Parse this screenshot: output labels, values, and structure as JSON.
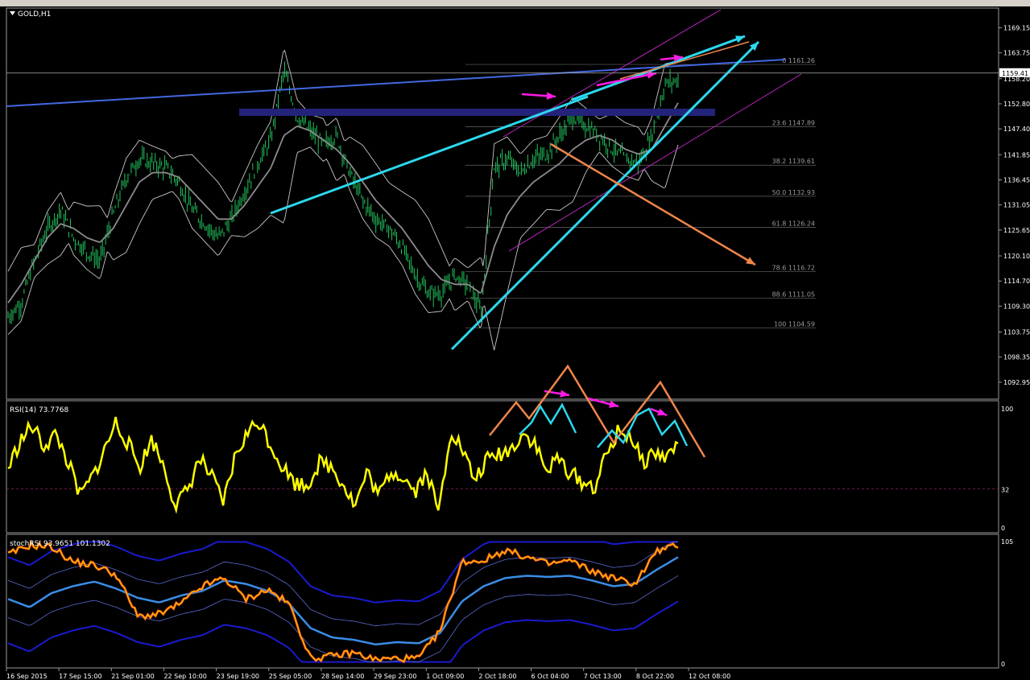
{
  "window": {
    "symbol_title": "GOLD,H1"
  },
  "chart_data": [
    {
      "type": "line",
      "title": "GOLD,H1",
      "price_axis_ticks": [
        "1169.15",
        "1163.75",
        "1158.20",
        "1152.80",
        "1147.40",
        "1141.85",
        "1136.45",
        "1131.05",
        "1125.65",
        "1120.10",
        "1114.70",
        "1109.30",
        "1103.75",
        "1098.35",
        "1092.95"
      ],
      "current_price": "1159.41",
      "ylim": [
        1090,
        1172
      ],
      "time_axis_labels": [
        "16 Sep 2015",
        "17 Sep 15:00",
        "21 Sep 01:00",
        "22 Sep 10:00",
        "23 Sep 19:00",
        "25 Sep 05:00",
        "28 Sep 14:00",
        "29 Sep 23:00",
        "1 Oct 09:00",
        "2 Oct 18:00",
        "6 Oct 04:00",
        "7 Oct 13:00",
        "8 Oct 22:00",
        "12 Oct 08:00"
      ],
      "fibonacci": [
        {
          "level": "0",
          "price": "1161.26"
        },
        {
          "level": "23.6",
          "price": "1147.89"
        },
        {
          "level": "38.2",
          "price": "1139.61"
        },
        {
          "level": "50.0",
          "price": "1132.93"
        },
        {
          "level": "61.8",
          "price": "1126.24"
        },
        {
          "level": "78.6",
          "price": "1116.72"
        },
        {
          "level": "88.6",
          "price": "1111.05"
        },
        {
          "level": "100",
          "price": "1104.59"
        }
      ],
      "series": [
        {
          "values": [
            1107,
            1110,
            1119,
            1126,
            1130,
            1124,
            1121,
            1119,
            1129,
            1137,
            1141,
            1140,
            1139,
            1136,
            1130,
            1127,
            1124,
            1128,
            1134,
            1140,
            1145,
            1160,
            1150,
            1147,
            1144,
            1146,
            1138,
            1132,
            1128,
            1126,
            1122,
            1116,
            1112,
            1112,
            1116,
            1114,
            1108,
            1139,
            1141,
            1138,
            1141,
            1142,
            1146,
            1150,
            1148,
            1146,
            1143,
            1141,
            1140,
            1146,
            1157,
            1158
          ]
        },
        {
          "values": [
            1110,
            1114,
            1119,
            1124,
            1127,
            1126,
            1124,
            1123,
            1126,
            1131,
            1136,
            1138,
            1138,
            1137,
            1134,
            1131,
            1128,
            1128,
            1131,
            1135,
            1139,
            1146,
            1148,
            1147,
            1145,
            1143,
            1140,
            1136,
            1132,
            1129,
            1126,
            1122,
            1118,
            1115,
            1114,
            1114,
            1112,
            1122,
            1129,
            1133,
            1136,
            1138,
            1140,
            1143,
            1145,
            1146,
            1145,
            1143,
            1142,
            1143,
            1148,
            1153
          ]
        }
      ]
    },
    {
      "type": "line",
      "title": "RSI(14) 73.7768",
      "levels": [
        "100",
        "32",
        "0"
      ],
      "ylim": [
        0,
        100
      ],
      "series": [
        {
          "values": [
            49,
            72,
            85,
            68,
            78,
            55,
            26,
            41,
            63,
            88,
            71,
            50,
            74,
            52,
            18,
            31,
            58,
            42,
            20,
            60,
            79,
            89,
            68,
            50,
            37,
            35,
            54,
            51,
            37,
            18,
            46,
            26,
            47,
            43,
            30,
            47,
            12,
            83,
            64,
            39,
            56,
            61,
            65,
            79,
            71,
            46,
            58,
            45,
            38,
            33,
            60,
            80,
            78,
            54,
            63,
            58,
            71
          ]
        }
      ]
    },
    {
      "type": "line",
      "title": "stochRSI 93.9651 101.1302",
      "levels": [
        "105",
        "0"
      ],
      "ylim": [
        0,
        105
      ],
      "series": [
        {
          "values": [
            93,
            101,
            100,
            87,
            84,
            76,
            40,
            42,
            51,
            66,
            73,
            55,
            63,
            51,
            4,
            6,
            9,
            3,
            4,
            4,
            28,
            87,
            88,
            97,
            91,
            85,
            88,
            79,
            73,
            68,
            96,
            101
          ]
        },
        {
          "values": [
            55,
            48,
            60,
            66,
            70,
            64,
            56,
            52,
            58,
            62,
            71,
            68,
            62,
            51,
            30,
            22,
            20,
            16,
            18,
            17,
            26,
            53,
            66,
            73,
            75,
            74,
            75,
            71,
            66,
            68,
            80,
            91
          ]
        }
      ]
    }
  ],
  "colors": {
    "background": "#000000",
    "candles": "#22c55e",
    "bollinger": "#c8c8c8",
    "ma": "#8c8c8c",
    "trend_blue": "#4468e0",
    "zone": "#23237a",
    "cyan": "#2cd8ee",
    "orange": "#f0854a",
    "magenta": "#ff1ce6",
    "channel": "#c428c8",
    "fib": "#666666",
    "rsi": "#ffff00",
    "stoch_fast": "#ffb000",
    "stoch_slow": "#3a8de8",
    "stoch_band": "#1a1ad0"
  },
  "icons": [
    "dropdown-triangle-icon"
  ]
}
